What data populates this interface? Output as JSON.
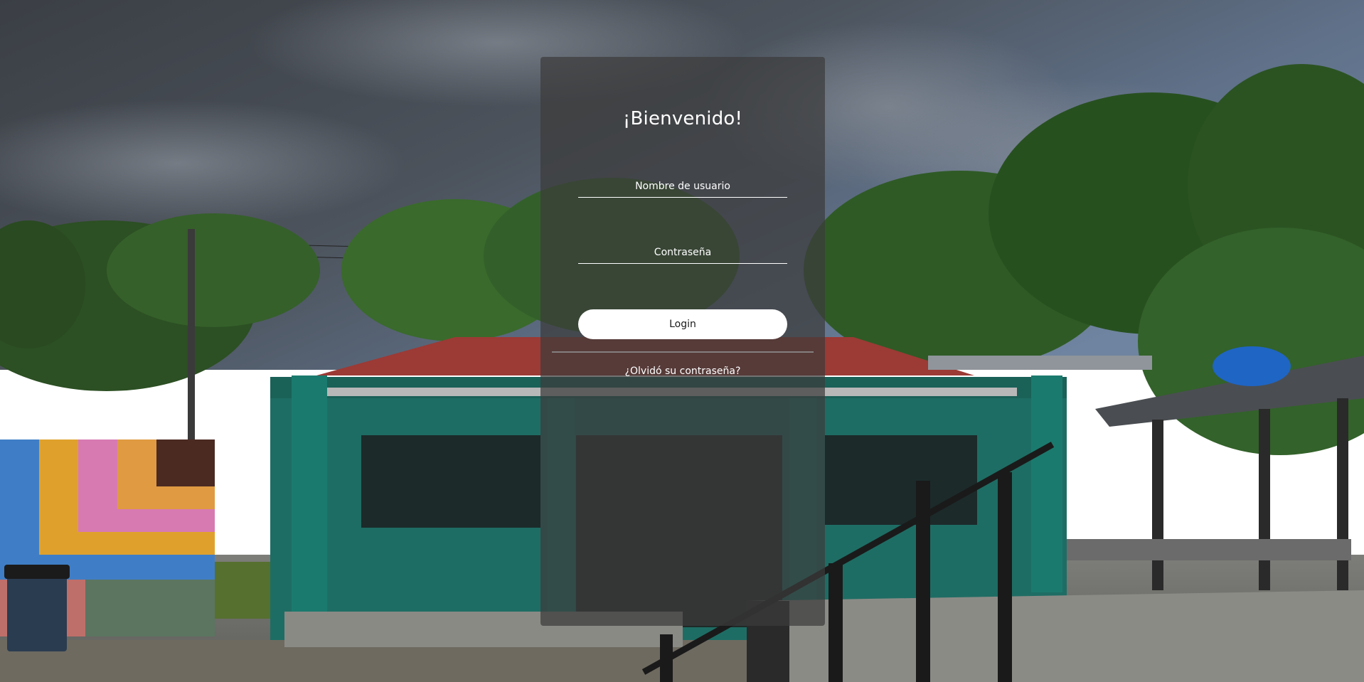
{
  "login": {
    "title": "¡Bienvenido!",
    "username_placeholder": "Nombre de usuario",
    "password_placeholder": "Contraseña",
    "login_label": "Login",
    "forgot_label": "¿Olvidó su contraseña?"
  },
  "colors": {
    "card_background": "#3c3c3c",
    "button_background": "#ffffff",
    "text": "#ffffff",
    "roof": "#9c3a35",
    "building": "#1f6f66",
    "sky": "#4a5766",
    "foliage": "#2f5a26"
  }
}
